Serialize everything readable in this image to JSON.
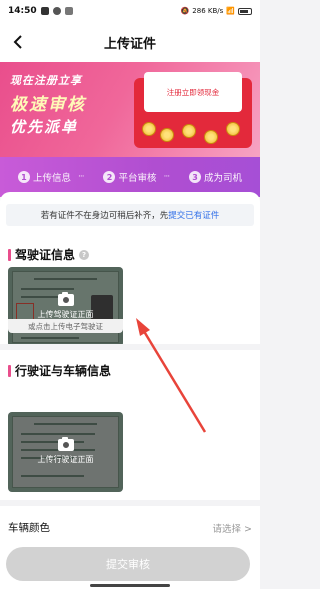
{
  "status_bar": {
    "time": "14:50",
    "network": "286 KB/s",
    "battery": "battery"
  },
  "navbar": {
    "title": "上传证件",
    "back_icon": "chevron-left-icon"
  },
  "banner": {
    "slogan_line1": "现在注册立享",
    "slogan_line2": "极速审核",
    "slogan_line3": "优先派单",
    "card_text": "注册立即领现金",
    "colors": {
      "bg_start": "#e94e8c",
      "envelope": "#e3293b"
    }
  },
  "steps": [
    {
      "num": "1",
      "label": "上传信息"
    },
    {
      "num": "2",
      "label": "平台审核"
    },
    {
      "num": "3",
      "label": "成为司机"
    }
  ],
  "notice": {
    "text": "若有证件不在身边可稍后补齐，先",
    "link": "提交已有证件"
  },
  "driver_license": {
    "title": "驾驶证信息",
    "help_icon": "help-icon",
    "upload_label": "上传驾驶证正面",
    "e_link": "或点击上传电子驾驶证"
  },
  "vehicle_license": {
    "title": "行驶证与车辆信息",
    "upload_label": "上传行驶证正面"
  },
  "vehicle_color": {
    "label": "车辆颜色",
    "value": "请选择 >"
  },
  "submit_button": {
    "label": "提交审核",
    "color": "#d2d2d2"
  }
}
